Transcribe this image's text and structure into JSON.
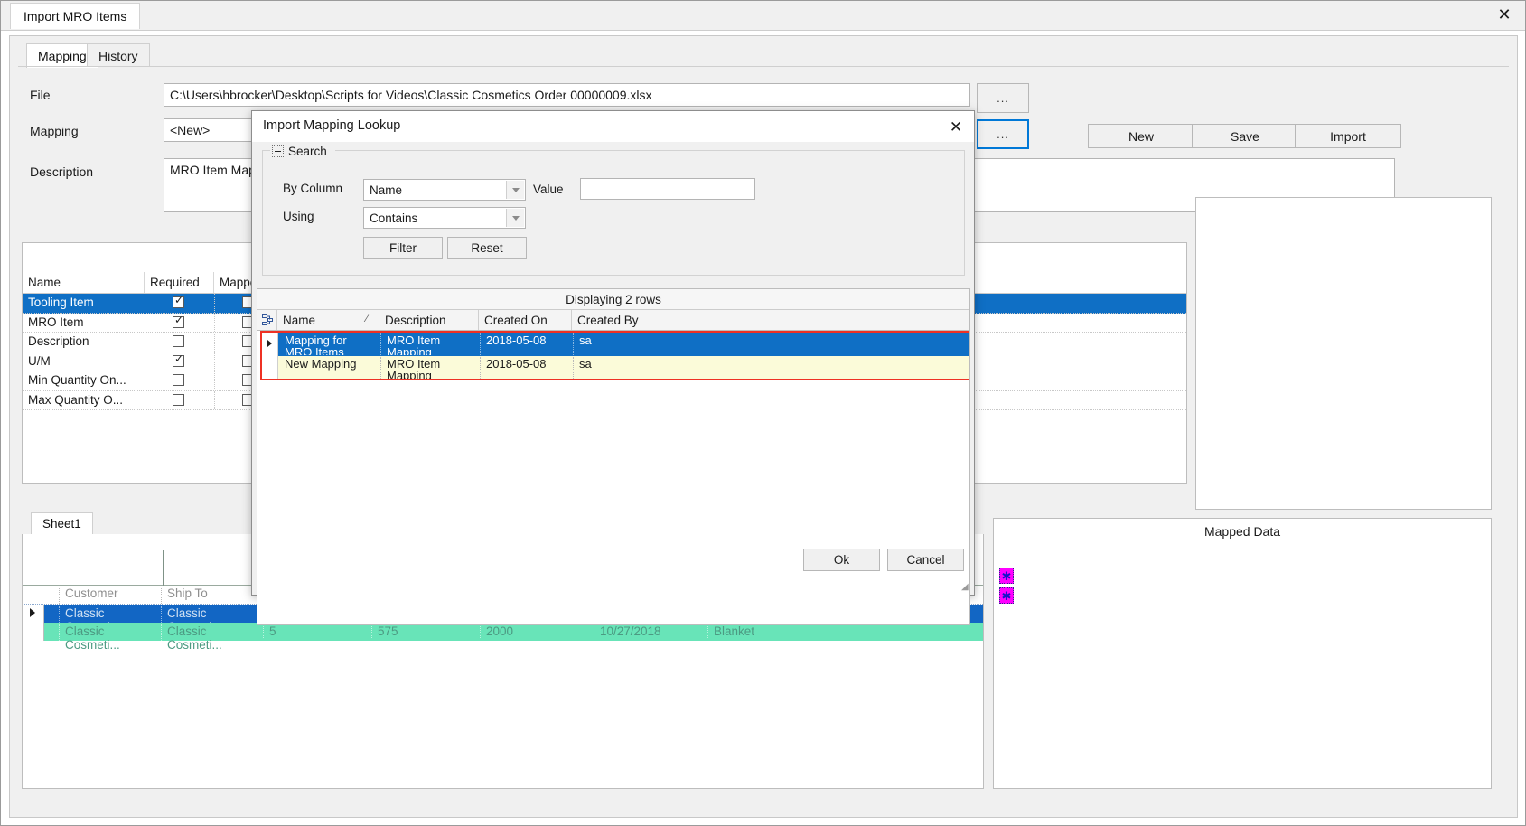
{
  "window": {
    "doc_tab_label": "Import MRO Items",
    "close_icon": "close-icon",
    "close_glyph": "✕"
  },
  "tabs": [
    {
      "label": "Mapping",
      "active": true
    },
    {
      "label": "History",
      "active": false
    }
  ],
  "form": {
    "file_label": "File",
    "file_value": "C:\\Users\\hbrocker\\Desktop\\Scripts for Videos\\Classic Cosmetics Order 00000009.xlsx",
    "file_browse_label": "...",
    "mapping_label": "Mapping",
    "mapping_value": "<New>",
    "mapping_browse_label": "...",
    "description_label": "Description",
    "description_value": "MRO Item Mapp"
  },
  "toolbar": {
    "new_label": "New",
    "save_label": "Save",
    "import_label": "Import"
  },
  "fields_grid": {
    "columns": [
      "Name",
      "Required",
      "Mapped"
    ],
    "rows": [
      {
        "name": "Tooling Item",
        "required": true,
        "mapped": false,
        "selected": true
      },
      {
        "name": "MRO Item",
        "required": true,
        "mapped": false,
        "selected": false
      },
      {
        "name": "Description",
        "required": false,
        "mapped": false,
        "selected": false
      },
      {
        "name": "U/M",
        "required": true,
        "mapped": false,
        "selected": false
      },
      {
        "name": "Min Quantity On...",
        "required": false,
        "mapped": false,
        "selected": false
      },
      {
        "name": "Max Quantity O...",
        "required": false,
        "mapped": false,
        "selected": false
      }
    ]
  },
  "sheet": {
    "tab_label": "Sheet1",
    "columns": [
      "Customer",
      "Ship To"
    ],
    "rows": [
      {
        "style": "blue",
        "cells": [
          "Classic Cosmeti...",
          "Classic Cosmeti..."
        ]
      },
      {
        "style": "green",
        "cells": [
          "Classic Cosmeti...",
          "Classic Cosmeti...",
          "5",
          "575",
          "2000",
          "10/27/2018",
          "Blanket"
        ]
      }
    ]
  },
  "mapped_data": {
    "title": "Mapped Data",
    "chips": [
      "star-chip",
      "star-chip"
    ],
    "chip_glyph": "✱"
  },
  "dialog": {
    "title": "Import Mapping Lookup",
    "close_glyph": "✕",
    "search": {
      "legend": "Search",
      "by_column_label": "By Column",
      "by_column_value": "Name",
      "value_label": "Value",
      "value_text": "",
      "using_label": "Using",
      "using_value": "Contains",
      "filter_label": "Filter",
      "reset_label": "Reset"
    },
    "results": {
      "caption": "Displaying 2 rows",
      "sort_glyph": "⁄",
      "columns": [
        "Name",
        "Description",
        "Created On",
        "Created By"
      ],
      "rows": [
        {
          "selected": true,
          "name": "Mapping for MRO Items",
          "description": "MRO Item Mapping",
          "created_on": "2018-05-08",
          "created_by": "sa"
        },
        {
          "selected": false,
          "name": "New Mapping",
          "description": "MRO Item Mapping",
          "created_on": "2018-05-08",
          "created_by": "sa"
        }
      ],
      "highlight_color": "#ee3124"
    },
    "ok_label": "Ok",
    "cancel_label": "Cancel"
  }
}
